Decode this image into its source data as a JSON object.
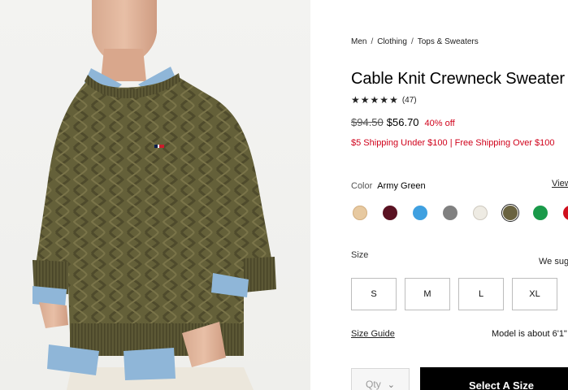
{
  "breadcrumb": [
    "Men",
    "Clothing",
    "Tops & Sweaters"
  ],
  "breadcrumb_separator": "/",
  "product": {
    "title": "Cable Knit Crewneck Sweater",
    "rating_stars": 5,
    "review_count": "(47)",
    "price_original": "$94.50",
    "price_sale": "$56.70",
    "discount": "40% off",
    "shipping_note": "$5 Shipping Under $100 | Free Shipping Over $100"
  },
  "color": {
    "label": "Color",
    "selected": "Army Green",
    "view_link": "View",
    "swatches": [
      {
        "name": "tan",
        "hex": "#e7c9a0",
        "selected": false
      },
      {
        "name": "burgundy",
        "hex": "#5a1222",
        "selected": false
      },
      {
        "name": "blue",
        "hex": "#3fa0e0",
        "selected": false
      },
      {
        "name": "grey",
        "hex": "#808080",
        "selected": false
      },
      {
        "name": "ivory",
        "hex": "#eeebe3",
        "selected": false
      },
      {
        "name": "army-green",
        "hex": "#6a6340",
        "selected": true
      },
      {
        "name": "green",
        "hex": "#1a9a4a",
        "selected": false
      },
      {
        "name": "red",
        "hex": "#d0101e",
        "selected": false
      }
    ]
  },
  "size": {
    "label": "Size",
    "suggest_text": "We sug",
    "options": [
      "S",
      "M",
      "L",
      "XL"
    ]
  },
  "size_guide": "Size Guide",
  "model_info": "Model is about 6'1\"",
  "quantity": {
    "placeholder": "Qty"
  },
  "cta": {
    "label": "Select A Size"
  },
  "colors": {
    "accent_red": "#d0021b",
    "cta_bg": "#000000"
  }
}
